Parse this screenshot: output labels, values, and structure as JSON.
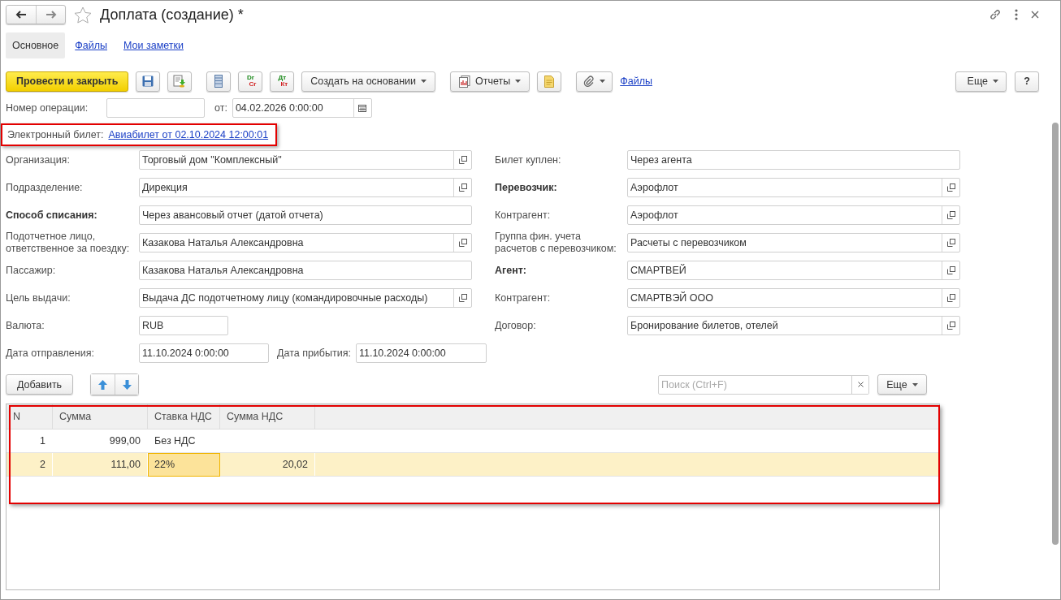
{
  "window": {
    "title": "Доплата (создание) *"
  },
  "tabs": [
    {
      "label": "Основное",
      "selected": true
    },
    {
      "label": "Файлы",
      "selected": false
    },
    {
      "label": "Мои заметки",
      "selected": false
    }
  ],
  "toolbar": {
    "primary": "Провести и закрыть",
    "dr": "Dr",
    "cr": "Cr",
    "dt": "Дт",
    "kt": "Кт",
    "create_based_on": "Создать на основании",
    "reports": "Отчеты",
    "files_link": "Файлы",
    "more": "Еще",
    "help": "?"
  },
  "header": {
    "number_label": "Номер операции:",
    "date_label": "от:",
    "date_value": "04.02.2026  0:00:00",
    "ticket_label": "Электронный билет:",
    "ticket_link": "Авиабилет  от 02.10.2024 12:00:01"
  },
  "left_fields": [
    {
      "label": "Организация:",
      "value": "Торговый дом \"Комплексный\"",
      "bold": false,
      "pick": true,
      "kind": "full"
    },
    {
      "label": "Подразделение:",
      "value": "Дирекция",
      "bold": false,
      "pick": true,
      "kind": "full"
    },
    {
      "label": "Способ списания:",
      "value": "Через авансовый отчет (датой отчета)",
      "bold": true,
      "pick": false,
      "kind": "full"
    },
    {
      "label": "Подотчетное лицо, ответственное за поездку:",
      "value": "Казакова Наталья Александровна",
      "bold": false,
      "pick": true,
      "kind": "full"
    },
    {
      "label": "Пассажир:",
      "value": "Казакова Наталья Александровна",
      "bold": false,
      "pick": false,
      "kind": "full"
    },
    {
      "label": "Цель выдачи:",
      "value": "Выдача ДС подотчетному лицу (командировочные расходы)",
      "bold": false,
      "pick": true,
      "kind": "full"
    },
    {
      "label": "Валюта:",
      "value": "RUB",
      "bold": false,
      "pick": false,
      "kind": "short"
    }
  ],
  "right_fields": [
    {
      "label": "Билет куплен:",
      "value": "Через агента",
      "bold": false,
      "pick": false
    },
    {
      "label": "Перевозчик:",
      "value": "Аэрофлот",
      "bold": true,
      "pick": true
    },
    {
      "label": "Контрагент:",
      "value": "Аэрофлот",
      "bold": false,
      "pick": true
    },
    {
      "label": "Группа фин. учета расчетов с перевозчиком:",
      "value": "Расчеты с перевозчиком",
      "bold": false,
      "pick": true
    },
    {
      "label": "Агент:",
      "value": "СМАРТВЕЙ",
      "bold": true,
      "pick": true
    },
    {
      "label": "Контрагент:",
      "value": "СМАРТВЭЙ ООО",
      "bold": false,
      "pick": true
    },
    {
      "label": "Договор:",
      "value": "Бронирование билетов, отелей",
      "bold": false,
      "pick": true
    }
  ],
  "dates": {
    "departure_label": "Дата отправления:",
    "departure_value": "11.10.2024  0:00:00",
    "arrival_label": "Дата прибытия:",
    "arrival_value": "11.10.2024  0:00:00"
  },
  "table_toolbar": {
    "add": "Добавить",
    "search_placeholder": "Поиск (Ctrl+F)",
    "more": "Еще"
  },
  "table": {
    "columns": [
      "N",
      "Сумма",
      "Ставка НДС",
      "Сумма НДС"
    ],
    "rows": [
      {
        "cells": [
          "1",
          "999,00",
          "Без НДС",
          ""
        ],
        "selected": false
      },
      {
        "cells": [
          "2",
          "111,00",
          "22%",
          "20,02"
        ],
        "selected": true
      }
    ]
  }
}
